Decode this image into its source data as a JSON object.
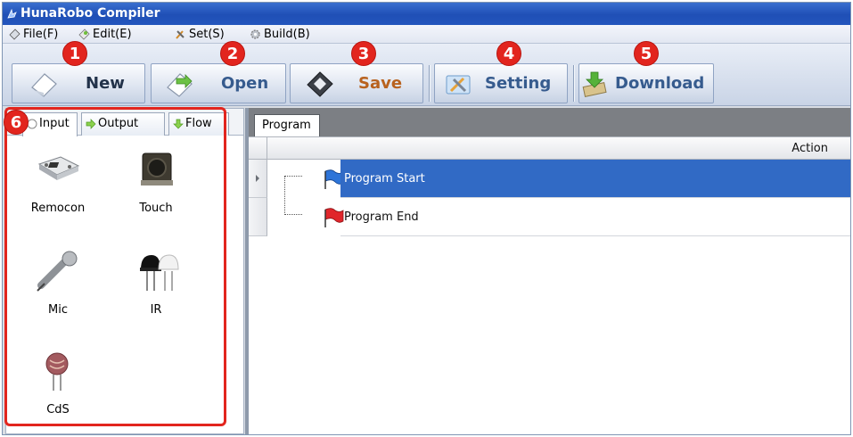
{
  "window": {
    "title": "HunaRobo Compiler"
  },
  "menu": {
    "file": "File(F)",
    "edit": "Edit(E)",
    "set": "Set(S)",
    "build": "Build(B)"
  },
  "toolbar": {
    "new_label": "New",
    "open_label": "Open",
    "save_label": "Save",
    "setting_label": "Setting",
    "download_label": "Download"
  },
  "callouts": [
    "1",
    "2",
    "3",
    "4",
    "5",
    "6"
  ],
  "left_tabs": [
    {
      "label": "Input",
      "icon": "input-icon"
    },
    {
      "label": "Output",
      "icon": "arrow-right-icon"
    },
    {
      "label": "Flow",
      "icon": "arrow-down-icon"
    }
  ],
  "palette": [
    {
      "label": "Remocon",
      "icon": "remote-control-module-icon"
    },
    {
      "label": "Touch",
      "icon": "tactile-switch-icon"
    },
    {
      "label": "Mic",
      "icon": "microphone-module-icon"
    },
    {
      "label": "IR",
      "icon": "ir-sensor-icon"
    },
    {
      "label": "CdS",
      "icon": "cds-photoresistor-icon"
    }
  ],
  "program": {
    "tab_label": "Program",
    "column_header": "Action",
    "rows": [
      {
        "label": "Program Start",
        "icon": "blue-flag-icon",
        "selected": true
      },
      {
        "label": "Program End",
        "icon": "red-flag-icon",
        "selected": false
      }
    ]
  },
  "colors": {
    "titlebar": "#2456bd",
    "callout": "#e2251e",
    "selection": "#316ac5",
    "accent_text": "#b8621f"
  }
}
